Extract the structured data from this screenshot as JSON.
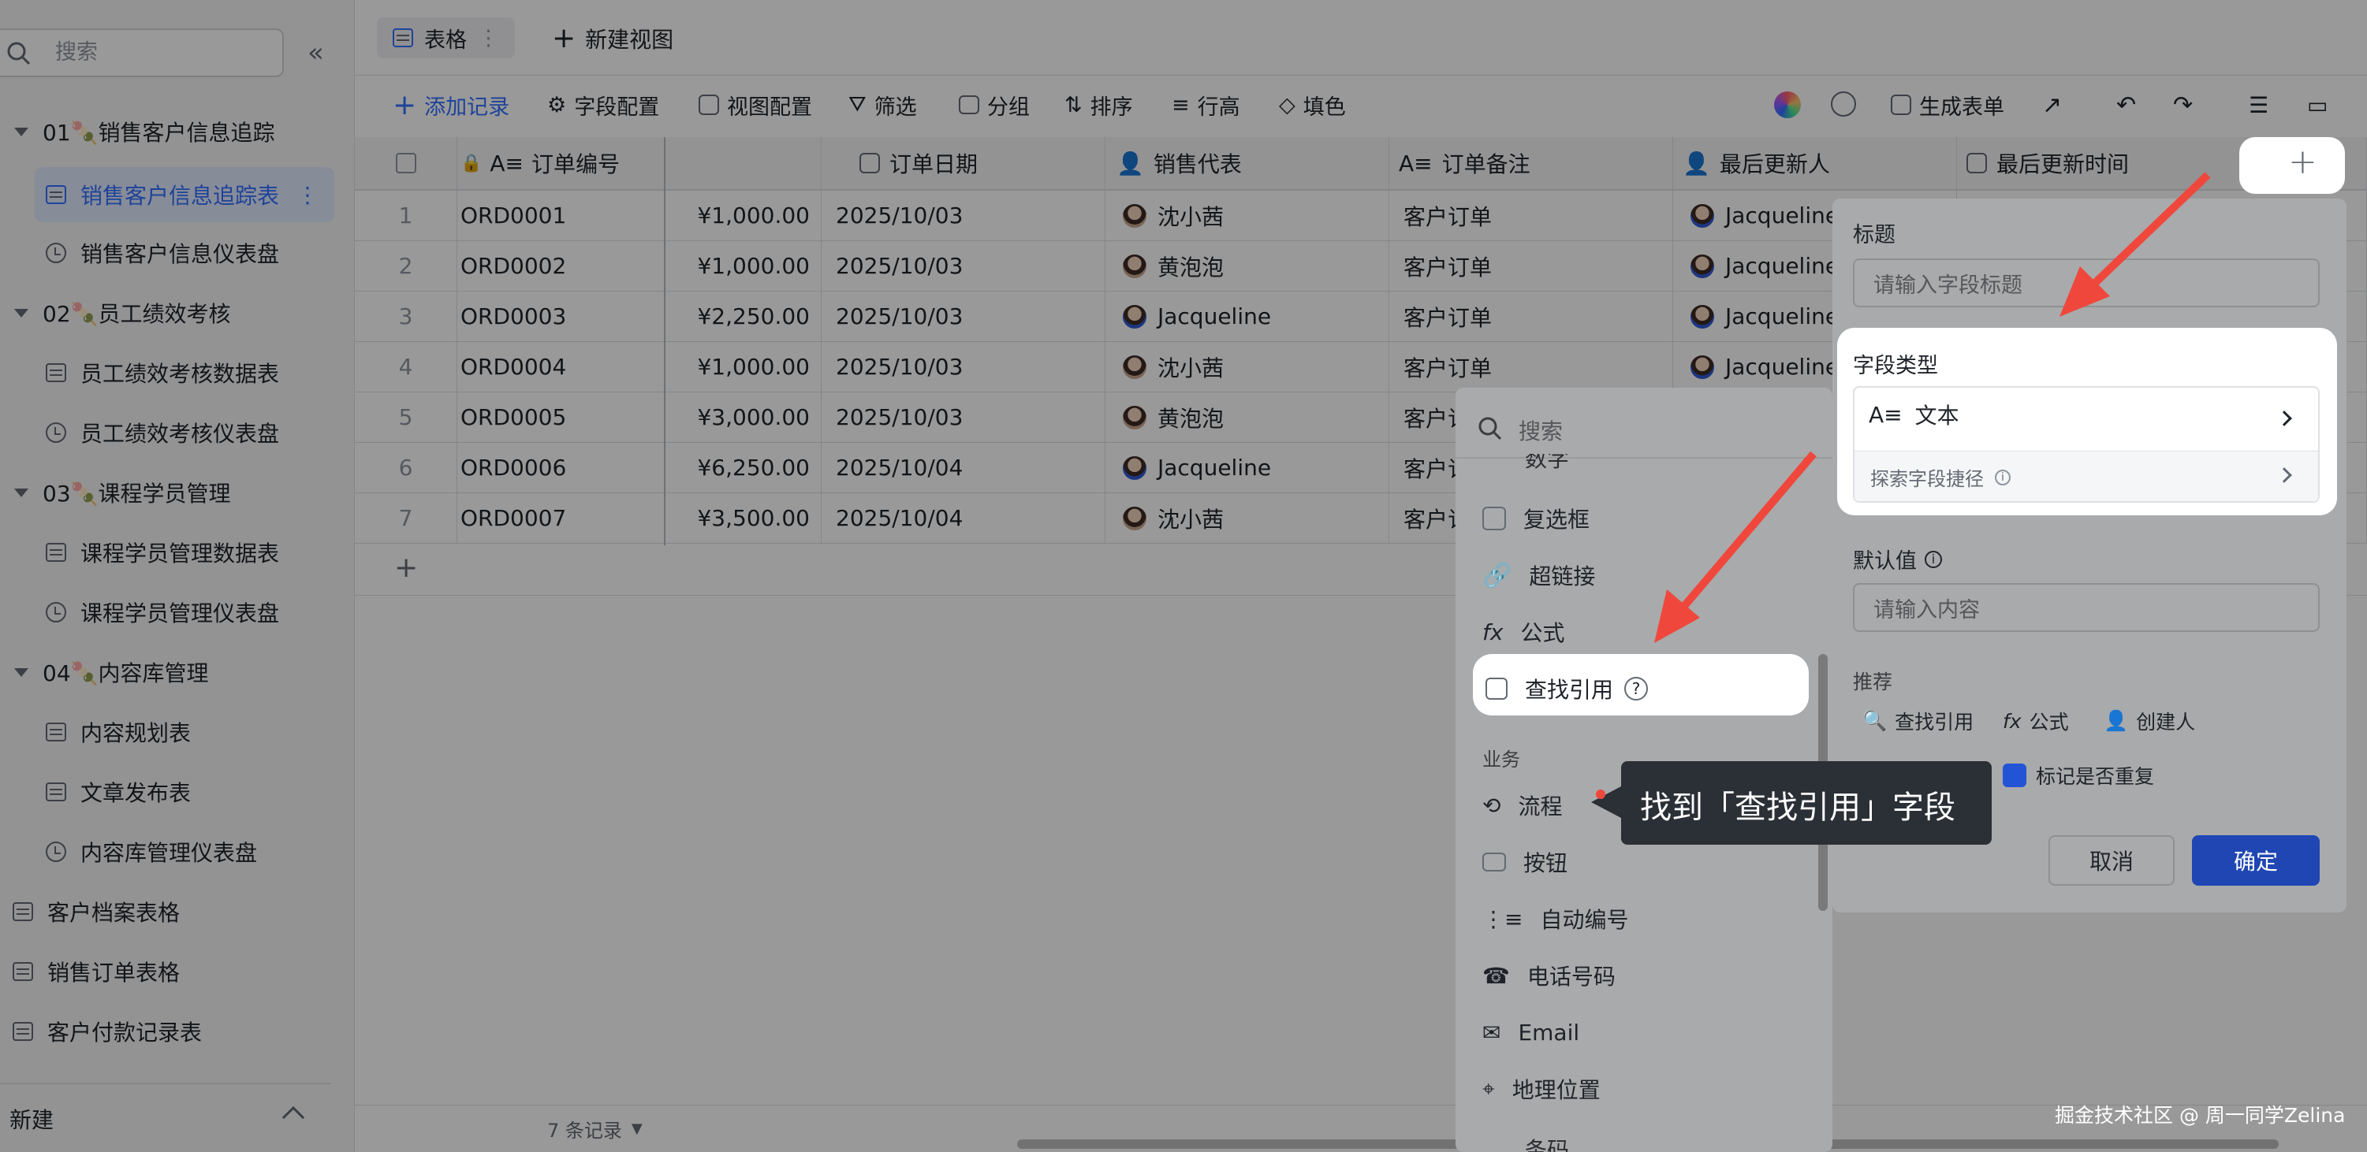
{
  "sidebar": {
    "search_placeholder": "搜索",
    "items": [
      {
        "label": "01🍡销售客户信息追踪"
      },
      {
        "label": "销售客户信息追踪表"
      },
      {
        "label": "销售客户信息仪表盘"
      },
      {
        "label": "02🍡员工绩效考核"
      },
      {
        "label": "员工绩效考核数据表"
      },
      {
        "label": "员工绩效考核仪表盘"
      },
      {
        "label": "03🍡课程学员管理"
      },
      {
        "label": "课程学员管理数据表"
      },
      {
        "label": "课程学员管理仪表盘"
      },
      {
        "label": "04🍡内容库管理"
      },
      {
        "label": "内容规划表"
      },
      {
        "label": "文章发布表"
      },
      {
        "label": "内容库管理仪表盘"
      },
      {
        "label": "客户档案表格"
      },
      {
        "label": "销售订单表格"
      },
      {
        "label": "客户付款记录表"
      }
    ],
    "new_label": "新建"
  },
  "tabs": {
    "table": "表格",
    "new_view": "新建视图"
  },
  "toolbar": {
    "add_record": "添加记录",
    "field_config": "字段配置",
    "view_config": "视图配置",
    "filter": "筛选",
    "group": "分组",
    "sort": "排序",
    "row_height": "行高",
    "fill_color": "填色",
    "generate_form": "生成表单"
  },
  "grid": {
    "headers": [
      "订单编号",
      "订单日期",
      "销售代表",
      "订单备注",
      "最后更新人",
      "最后更新时间"
    ],
    "rows": [
      {
        "num": "1",
        "id": "ORD0001",
        "amount": "¥1,000.00",
        "date": "2025/10/03",
        "rep": "沈小茜",
        "note": "客户订单",
        "updater": "Jacqueline"
      },
      {
        "num": "2",
        "id": "ORD0002",
        "amount": "¥1,000.00",
        "date": "2025/10/03",
        "rep": "黄泡泡",
        "note": "客户订单",
        "updater": "Jacqueline"
      },
      {
        "num": "3",
        "id": "ORD0003",
        "amount": "¥2,250.00",
        "date": "2025/10/03",
        "rep": "Jacqueline",
        "note": "客户订单",
        "updater": "Jacqueline"
      },
      {
        "num": "4",
        "id": "ORD0004",
        "amount": "¥1,000.00",
        "date": "2025/10/03",
        "rep": "沈小茜",
        "note": "客户订单",
        "updater": "Jacqueline"
      },
      {
        "num": "5",
        "id": "ORD0005",
        "amount": "¥3,000.00",
        "date": "2025/10/03",
        "rep": "黄泡泡",
        "note": "客户订",
        "updater": ""
      },
      {
        "num": "6",
        "id": "ORD0006",
        "amount": "¥6,250.00",
        "date": "2025/10/04",
        "rep": "Jacqueline",
        "note": "客户订",
        "updater": ""
      },
      {
        "num": "7",
        "id": "ORD0007",
        "amount": "¥3,500.00",
        "date": "2025/10/04",
        "rep": "沈小茜",
        "note": "客户订",
        "updater": ""
      }
    ],
    "record_count": "7 条记录"
  },
  "field_panel": {
    "title_label": "标题",
    "title_placeholder": "请输入字段标题",
    "type_label": "字段类型",
    "type_value": "文本",
    "explore_shortcut": "探索字段捷径",
    "default_label": "默认值",
    "default_placeholder": "请输入内容",
    "recommend_label": "推荐",
    "chips": [
      "查找引用",
      "公式",
      "创建人"
    ],
    "mark_duplicate": "标记是否重复",
    "cancel": "取消",
    "confirm": "确定"
  },
  "type_menu": {
    "search_placeholder": "搜索",
    "items_top": [
      "复选框",
      "超链接",
      "公式",
      "查找引用"
    ],
    "section_business": "业务",
    "items_business": [
      "流程",
      "按钮",
      "自动编号",
      "电话号码",
      "Email",
      "地理位置"
    ],
    "partial_top": "数字",
    "partial_bottom": "条码"
  },
  "tooltip": "找到「查找引用」字段",
  "watermark": "掘金技术社区 @ 周一同学Zelina",
  "colors": {
    "accent": "#3370ff",
    "confirm": "#2454d6",
    "arrow": "#f0473c",
    "active_bg": "#e1eaff"
  }
}
